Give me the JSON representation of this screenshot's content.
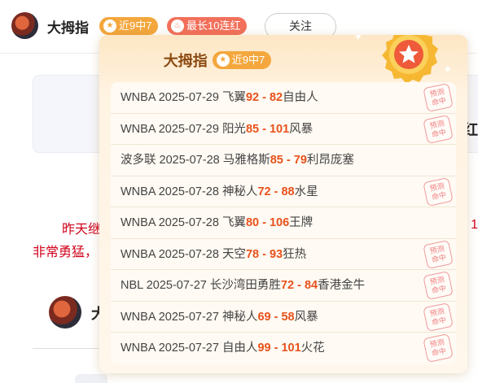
{
  "header": {
    "user_name": "大拇指",
    "streak_badge": "近9中7",
    "max_badge": "最长10连红",
    "follow_label": "关注"
  },
  "background": {
    "card_char": "红",
    "red_text_1": "昨天继",
    "red_text_2": "非常勇猛，",
    "red_text_right": "1",
    "partial_name": "大"
  },
  "popup": {
    "title": "大拇指",
    "badge": "近9中7",
    "stamp_label_top": "预测",
    "stamp_label_bottom": "命中",
    "matches": [
      {
        "league": "WNBA",
        "date": "2025-07-29",
        "home": "飞翼",
        "home_score": "92",
        "away_score": "82",
        "away": "自由人",
        "hit": true
      },
      {
        "league": "WNBA",
        "date": "2025-07-29",
        "home": "阳光",
        "home_score": "85",
        "away_score": "101",
        "away": "风暴",
        "hit": true
      },
      {
        "league": "波多联",
        "date": "2025-07-28",
        "home": "马雅格斯",
        "home_score": "85",
        "away_score": "79",
        "away": "利昂庞塞",
        "hit": false
      },
      {
        "league": "WNBA",
        "date": "2025-07-28",
        "home": "神秘人",
        "home_score": "72",
        "away_score": "88",
        "away": "水星",
        "hit": true
      },
      {
        "league": "WNBA",
        "date": "2025-07-28",
        "home": "飞翼",
        "home_score": "80",
        "away_score": "106",
        "away": "王牌",
        "hit": false
      },
      {
        "league": "WNBA",
        "date": "2025-07-28",
        "home": "天空",
        "home_score": "78",
        "away_score": "93",
        "away": "狂热",
        "hit": true
      },
      {
        "league": "NBL",
        "date": "2025-07-27",
        "home": "长沙湾田勇胜",
        "home_score": "72",
        "away_score": "84",
        "away": "香港金牛",
        "hit": true
      },
      {
        "league": "WNBA",
        "date": "2025-07-27",
        "home": "神秘人",
        "home_score": "69",
        "away_score": "58",
        "away": "风暴",
        "hit": true
      },
      {
        "league": "WNBA",
        "date": "2025-07-27",
        "home": "自由人",
        "home_score": "99",
        "away_score": "101",
        "away": "火花",
        "hit": true
      }
    ]
  },
  "colors": {
    "score": "#e8521c",
    "streak_badge": "#f4a73d",
    "max_badge": "#f2705b",
    "title": "#8a4a10",
    "stamp": "#f08080"
  },
  "icons": {
    "streak": "star-icon",
    "max": "flame-icon",
    "medal": "medal-star-icon",
    "stamp": "prediction-hit-stamp-icon"
  }
}
